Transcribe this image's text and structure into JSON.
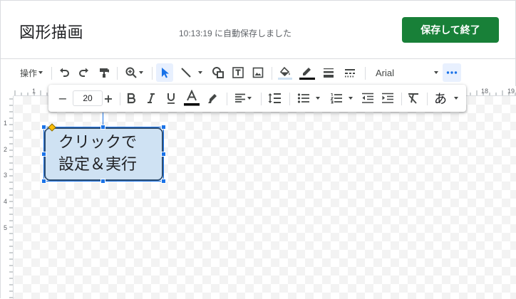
{
  "header": {
    "title": "図形描画",
    "autosave_status": "10:13:19 に自動保存しました",
    "save_button": "保存して終了"
  },
  "toolbar": {
    "actions_menu": "操作",
    "font_name": "Arial"
  },
  "format_toolbar": {
    "font_size": "20",
    "minus": "−",
    "plus": "+",
    "input_tools_glyph": "あ"
  },
  "shape": {
    "text_line1": "クリックで",
    "text_line2": "設定＆実行",
    "fill_color": "#cfe2f3",
    "border_color": "#2f4f73"
  },
  "ruler": {
    "top_numbers": [
      "1",
      "18",
      "19"
    ],
    "left_numbers": [
      "1",
      "2",
      "3",
      "4",
      "5"
    ]
  },
  "colors": {
    "accent": "#1a73e8",
    "save_button": "#188038",
    "line_color_bar": "#000000"
  }
}
